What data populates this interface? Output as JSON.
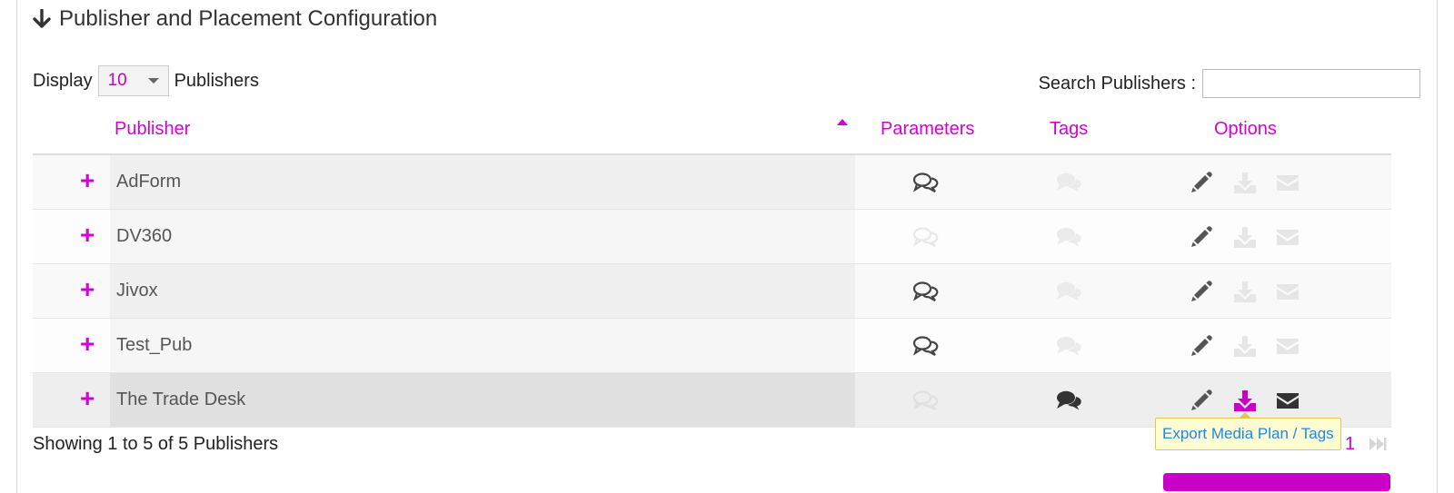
{
  "section": {
    "title": "Publisher and Placement Configuration"
  },
  "length": {
    "prefix": "Display",
    "value": "10",
    "suffix": "Publishers"
  },
  "search": {
    "label": "Search Publishers :",
    "value": ""
  },
  "table": {
    "headers": {
      "publisher": "Publisher",
      "parameters": "Parameters",
      "tags": "Tags",
      "options": "Options"
    },
    "rows": [
      {
        "name": "AdForm"
      },
      {
        "name": "DV360"
      },
      {
        "name": "Jivox"
      },
      {
        "name": "Test_Pub"
      },
      {
        "name": "The Trade Desk"
      }
    ]
  },
  "footer": {
    "info": "Showing 1 to 5 of 5 Publishers",
    "tooltip": "Export Media Plan / Tags",
    "page": "1"
  },
  "colors": {
    "accent": "#d400d4",
    "tooltip_text": "#1e88e5"
  }
}
